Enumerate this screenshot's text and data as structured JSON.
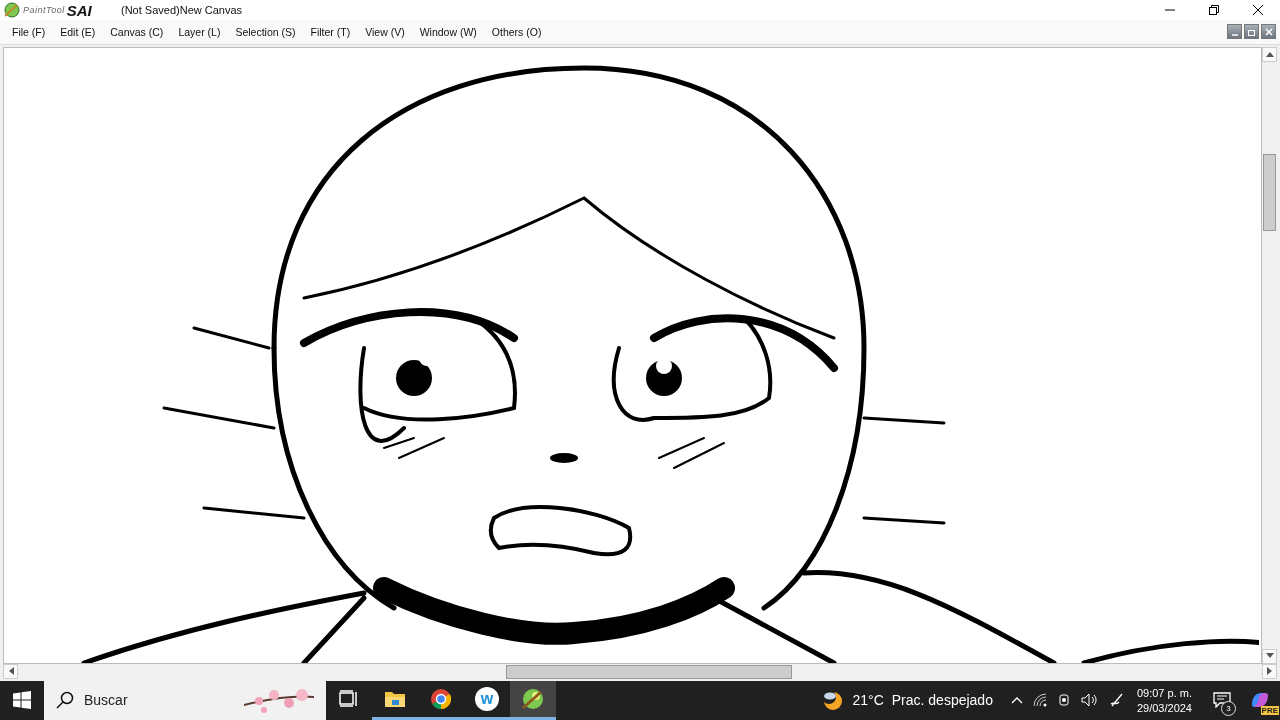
{
  "window": {
    "logo_small": "PaintTool",
    "logo_big": "SAI",
    "title": "(Not Saved)New Canvas"
  },
  "menu": [
    {
      "label": "File (F)"
    },
    {
      "label": "Edit (E)"
    },
    {
      "label": "Canvas (C)"
    },
    {
      "label": "Layer (L)"
    },
    {
      "label": "Selection (S)"
    },
    {
      "label": "Filter (T)"
    },
    {
      "label": "View (V)"
    },
    {
      "label": "Window (W)"
    },
    {
      "label": "Others (O)"
    }
  ],
  "taskbar": {
    "search": {
      "placeholder": "Buscar"
    },
    "apps": [
      {
        "kind": "taskview",
        "running": false,
        "selected": false
      },
      {
        "kind": "folder",
        "running": true,
        "selected": false
      },
      {
        "kind": "chrome",
        "running": true,
        "selected": false
      },
      {
        "kind": "w",
        "running": true,
        "selected": false,
        "letter": "w"
      },
      {
        "kind": "sai",
        "running": true,
        "selected": true
      }
    ],
    "weather": {
      "temp": "21°C",
      "text": "Prac. despejado"
    },
    "time": "09:07 p. m.",
    "date": "29/03/2024",
    "notifications": "3",
    "copilot_badge": "PRE"
  }
}
